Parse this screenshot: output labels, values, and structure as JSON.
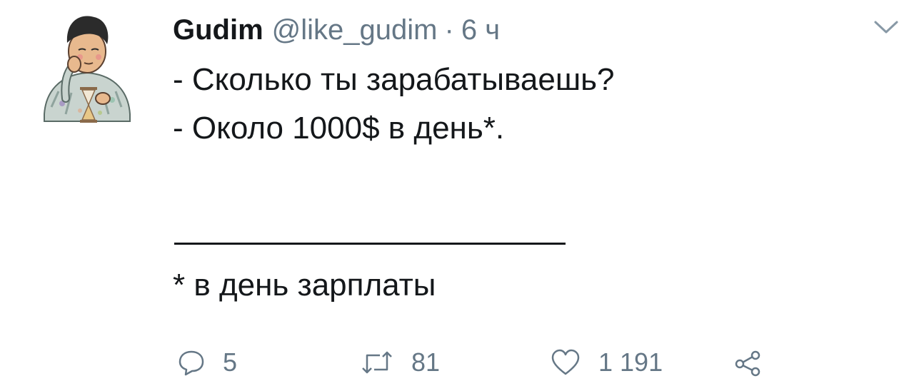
{
  "tweet": {
    "display_name": "Gudim",
    "handle": "@like_gudim",
    "separator": "·",
    "time": "6 ч",
    "text_line_1": "- Сколько ты зарабатываешь?",
    "text_line_2": "- Около 1000$ в день*.",
    "footnote": "* в день зарплаты"
  },
  "actions": {
    "reply_count": "5",
    "retweet_count": "81",
    "like_count": "1 191"
  },
  "icons": {
    "reply": "reply-icon",
    "retweet": "retweet-icon",
    "like": "heart-icon",
    "share": "share-icon",
    "menu": "chevron-down-icon"
  },
  "colors": {
    "text": "#14171a",
    "secondary": "#657786",
    "background": "#ffffff"
  }
}
